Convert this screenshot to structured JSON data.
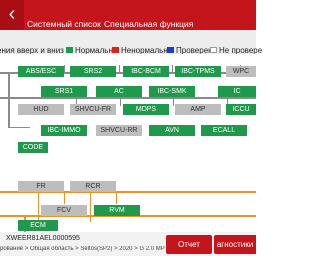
{
  "header": {
    "back_icon": "‹",
    "tabs": [
      {
        "label": "Системный список"
      },
      {
        "label": "Специальная функция"
      }
    ]
  },
  "legend": {
    "items": [
      {
        "label": "ения вверх и вниз",
        "color": ""
      },
      {
        "label": "Нормально",
        "color": "#1f9a4c"
      },
      {
        "label": "Ненормально",
        "color": "#d9261c"
      },
      {
        "label": "Проверено",
        "color": "#1a3fcf"
      },
      {
        "label": "Не провере",
        "color": "#ffffff"
      }
    ]
  },
  "topology": {
    "nodes": [
      {
        "label": "ABS/ESC",
        "status": "normal"
      },
      {
        "label": "SRS2",
        "status": "normal"
      },
      {
        "label": "IBC-BCM",
        "status": "normal"
      },
      {
        "label": "IBC-TPMS",
        "status": "normal"
      },
      {
        "label": "WPC",
        "status": "unchecked"
      },
      {
        "label": "SRS1",
        "status": "normal"
      },
      {
        "label": "AC",
        "status": "normal"
      },
      {
        "label": "IBC-SMK",
        "status": "normal"
      },
      {
        "label": "IC",
        "status": "normal"
      },
      {
        "label": "HUD",
        "status": "unchecked"
      },
      {
        "label": "SHVCU-FR",
        "status": "unchecked"
      },
      {
        "label": "MDPS",
        "status": "normal"
      },
      {
        "label": "AMP",
        "status": "unchecked"
      },
      {
        "label": "ICCU",
        "status": "normal"
      },
      {
        "label": "IBC-IMMO",
        "status": "normal"
      },
      {
        "label": "SHVCU-RR",
        "status": "unchecked"
      },
      {
        "label": "AVN",
        "status": "normal"
      },
      {
        "label": "ECALL",
        "status": "normal"
      },
      {
        "label": "CODE",
        "status": "normal"
      },
      {
        "label": "FR",
        "status": "unchecked"
      },
      {
        "label": "RCR",
        "status": "unchecked"
      },
      {
        "label": "FCV",
        "status": "unchecked"
      },
      {
        "label": "RVM",
        "status": "normal"
      },
      {
        "label": "ECM",
        "status": "normal"
      }
    ],
    "bus_colors": {
      "gray_bus": "#8a8a8a",
      "orange_bus": "#f0922a"
    }
  },
  "footer": {
    "vin": "XWEER81AEL0000595",
    "path": "рование > Общая область > Seltos(SP2) > 2020 > G 2.0 MPI",
    "buttons": {
      "report": "Отчет",
      "diagnostics": "агностики"
    }
  },
  "colors": {
    "accent": "#c4151c",
    "normal": "#1f9a4c",
    "unchecked": "#bdbdbd"
  }
}
